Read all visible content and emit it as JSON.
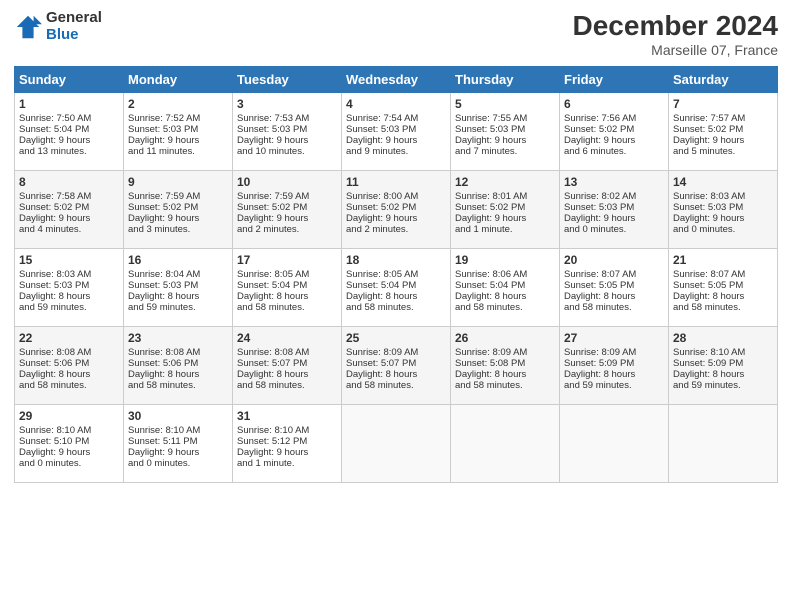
{
  "header": {
    "logo_general": "General",
    "logo_blue": "Blue",
    "title": "December 2024",
    "subtitle": "Marseille 07, France"
  },
  "days_of_week": [
    "Sunday",
    "Monday",
    "Tuesday",
    "Wednesday",
    "Thursday",
    "Friday",
    "Saturday"
  ],
  "weeks": [
    [
      {
        "day": "1",
        "lines": [
          "Sunrise: 7:50 AM",
          "Sunset: 5:04 PM",
          "Daylight: 9 hours",
          "and 13 minutes."
        ]
      },
      {
        "day": "2",
        "lines": [
          "Sunrise: 7:52 AM",
          "Sunset: 5:03 PM",
          "Daylight: 9 hours",
          "and 11 minutes."
        ]
      },
      {
        "day": "3",
        "lines": [
          "Sunrise: 7:53 AM",
          "Sunset: 5:03 PM",
          "Daylight: 9 hours",
          "and 10 minutes."
        ]
      },
      {
        "day": "4",
        "lines": [
          "Sunrise: 7:54 AM",
          "Sunset: 5:03 PM",
          "Daylight: 9 hours",
          "and 9 minutes."
        ]
      },
      {
        "day": "5",
        "lines": [
          "Sunrise: 7:55 AM",
          "Sunset: 5:03 PM",
          "Daylight: 9 hours",
          "and 7 minutes."
        ]
      },
      {
        "day": "6",
        "lines": [
          "Sunrise: 7:56 AM",
          "Sunset: 5:02 PM",
          "Daylight: 9 hours",
          "and 6 minutes."
        ]
      },
      {
        "day": "7",
        "lines": [
          "Sunrise: 7:57 AM",
          "Sunset: 5:02 PM",
          "Daylight: 9 hours",
          "and 5 minutes."
        ]
      }
    ],
    [
      {
        "day": "8",
        "lines": [
          "Sunrise: 7:58 AM",
          "Sunset: 5:02 PM",
          "Daylight: 9 hours",
          "and 4 minutes."
        ]
      },
      {
        "day": "9",
        "lines": [
          "Sunrise: 7:59 AM",
          "Sunset: 5:02 PM",
          "Daylight: 9 hours",
          "and 3 minutes."
        ]
      },
      {
        "day": "10",
        "lines": [
          "Sunrise: 7:59 AM",
          "Sunset: 5:02 PM",
          "Daylight: 9 hours",
          "and 2 minutes."
        ]
      },
      {
        "day": "11",
        "lines": [
          "Sunrise: 8:00 AM",
          "Sunset: 5:02 PM",
          "Daylight: 9 hours",
          "and 2 minutes."
        ]
      },
      {
        "day": "12",
        "lines": [
          "Sunrise: 8:01 AM",
          "Sunset: 5:02 PM",
          "Daylight: 9 hours",
          "and 1 minute."
        ]
      },
      {
        "day": "13",
        "lines": [
          "Sunrise: 8:02 AM",
          "Sunset: 5:03 PM",
          "Daylight: 9 hours",
          "and 0 minutes."
        ]
      },
      {
        "day": "14",
        "lines": [
          "Sunrise: 8:03 AM",
          "Sunset: 5:03 PM",
          "Daylight: 9 hours",
          "and 0 minutes."
        ]
      }
    ],
    [
      {
        "day": "15",
        "lines": [
          "Sunrise: 8:03 AM",
          "Sunset: 5:03 PM",
          "Daylight: 8 hours",
          "and 59 minutes."
        ]
      },
      {
        "day": "16",
        "lines": [
          "Sunrise: 8:04 AM",
          "Sunset: 5:03 PM",
          "Daylight: 8 hours",
          "and 59 minutes."
        ]
      },
      {
        "day": "17",
        "lines": [
          "Sunrise: 8:05 AM",
          "Sunset: 5:04 PM",
          "Daylight: 8 hours",
          "and 58 minutes."
        ]
      },
      {
        "day": "18",
        "lines": [
          "Sunrise: 8:05 AM",
          "Sunset: 5:04 PM",
          "Daylight: 8 hours",
          "and 58 minutes."
        ]
      },
      {
        "day": "19",
        "lines": [
          "Sunrise: 8:06 AM",
          "Sunset: 5:04 PM",
          "Daylight: 8 hours",
          "and 58 minutes."
        ]
      },
      {
        "day": "20",
        "lines": [
          "Sunrise: 8:07 AM",
          "Sunset: 5:05 PM",
          "Daylight: 8 hours",
          "and 58 minutes."
        ]
      },
      {
        "day": "21",
        "lines": [
          "Sunrise: 8:07 AM",
          "Sunset: 5:05 PM",
          "Daylight: 8 hours",
          "and 58 minutes."
        ]
      }
    ],
    [
      {
        "day": "22",
        "lines": [
          "Sunrise: 8:08 AM",
          "Sunset: 5:06 PM",
          "Daylight: 8 hours",
          "and 58 minutes."
        ]
      },
      {
        "day": "23",
        "lines": [
          "Sunrise: 8:08 AM",
          "Sunset: 5:06 PM",
          "Daylight: 8 hours",
          "and 58 minutes."
        ]
      },
      {
        "day": "24",
        "lines": [
          "Sunrise: 8:08 AM",
          "Sunset: 5:07 PM",
          "Daylight: 8 hours",
          "and 58 minutes."
        ]
      },
      {
        "day": "25",
        "lines": [
          "Sunrise: 8:09 AM",
          "Sunset: 5:07 PM",
          "Daylight: 8 hours",
          "and 58 minutes."
        ]
      },
      {
        "day": "26",
        "lines": [
          "Sunrise: 8:09 AM",
          "Sunset: 5:08 PM",
          "Daylight: 8 hours",
          "and 58 minutes."
        ]
      },
      {
        "day": "27",
        "lines": [
          "Sunrise: 8:09 AM",
          "Sunset: 5:09 PM",
          "Daylight: 8 hours",
          "and 59 minutes."
        ]
      },
      {
        "day": "28",
        "lines": [
          "Sunrise: 8:10 AM",
          "Sunset: 5:09 PM",
          "Daylight: 8 hours",
          "and 59 minutes."
        ]
      }
    ],
    [
      {
        "day": "29",
        "lines": [
          "Sunrise: 8:10 AM",
          "Sunset: 5:10 PM",
          "Daylight: 9 hours",
          "and 0 minutes."
        ]
      },
      {
        "day": "30",
        "lines": [
          "Sunrise: 8:10 AM",
          "Sunset: 5:11 PM",
          "Daylight: 9 hours",
          "and 0 minutes."
        ]
      },
      {
        "day": "31",
        "lines": [
          "Sunrise: 8:10 AM",
          "Sunset: 5:12 PM",
          "Daylight: 9 hours",
          "and 1 minute."
        ]
      },
      {
        "day": "",
        "lines": []
      },
      {
        "day": "",
        "lines": []
      },
      {
        "day": "",
        "lines": []
      },
      {
        "day": "",
        "lines": []
      }
    ]
  ]
}
